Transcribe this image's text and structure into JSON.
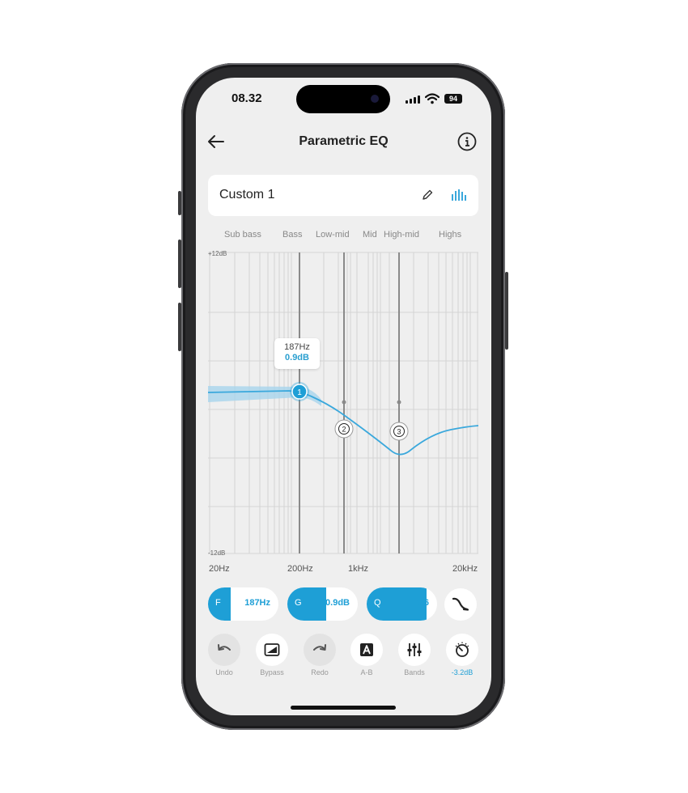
{
  "status": {
    "time": "08.32",
    "battery": "94"
  },
  "nav": {
    "title": "Parametric EQ"
  },
  "preset": {
    "name": "Custom 1"
  },
  "bands": [
    "Sub bass",
    "Bass",
    "Low-mid",
    "Mid",
    "High-mid",
    "Highs"
  ],
  "graph": {
    "y_top_label": "+12dB",
    "y_bottom_label": "-12dB",
    "x_labels": [
      "20Hz",
      "200Hz",
      "1kHz",
      "20kHz"
    ],
    "nodes": [
      {
        "id": "1",
        "frequency_hz": 187,
        "selected": true
      },
      {
        "id": "2",
        "selected": false
      },
      {
        "id": "3",
        "selected": false
      }
    ],
    "tooltip": {
      "freq": "187Hz",
      "gain": "0.9dB"
    }
  },
  "params": {
    "f": {
      "letter": "F",
      "value": "187Hz",
      "fill": 0.32
    },
    "g": {
      "letter": "G",
      "value": "0.9dB",
      "fill": 0.55
    },
    "q": {
      "letter": "Q",
      "value": "0.6",
      "fill": 0.85
    }
  },
  "tools": [
    {
      "label": "Undo",
      "icon": "undo-icon"
    },
    {
      "label": "Bypass",
      "icon": "bypass-icon"
    },
    {
      "label": "Redo",
      "icon": "redo-icon"
    },
    {
      "label": "A-B",
      "icon": "ab-icon"
    },
    {
      "label": "Bands",
      "icon": "sliders-icon"
    },
    {
      "label": "-3.2dB",
      "icon": "gain-knob-icon"
    }
  ],
  "colors": {
    "accent": "#1e9fd6",
    "background": "#efefef",
    "card": "#ffffff"
  }
}
